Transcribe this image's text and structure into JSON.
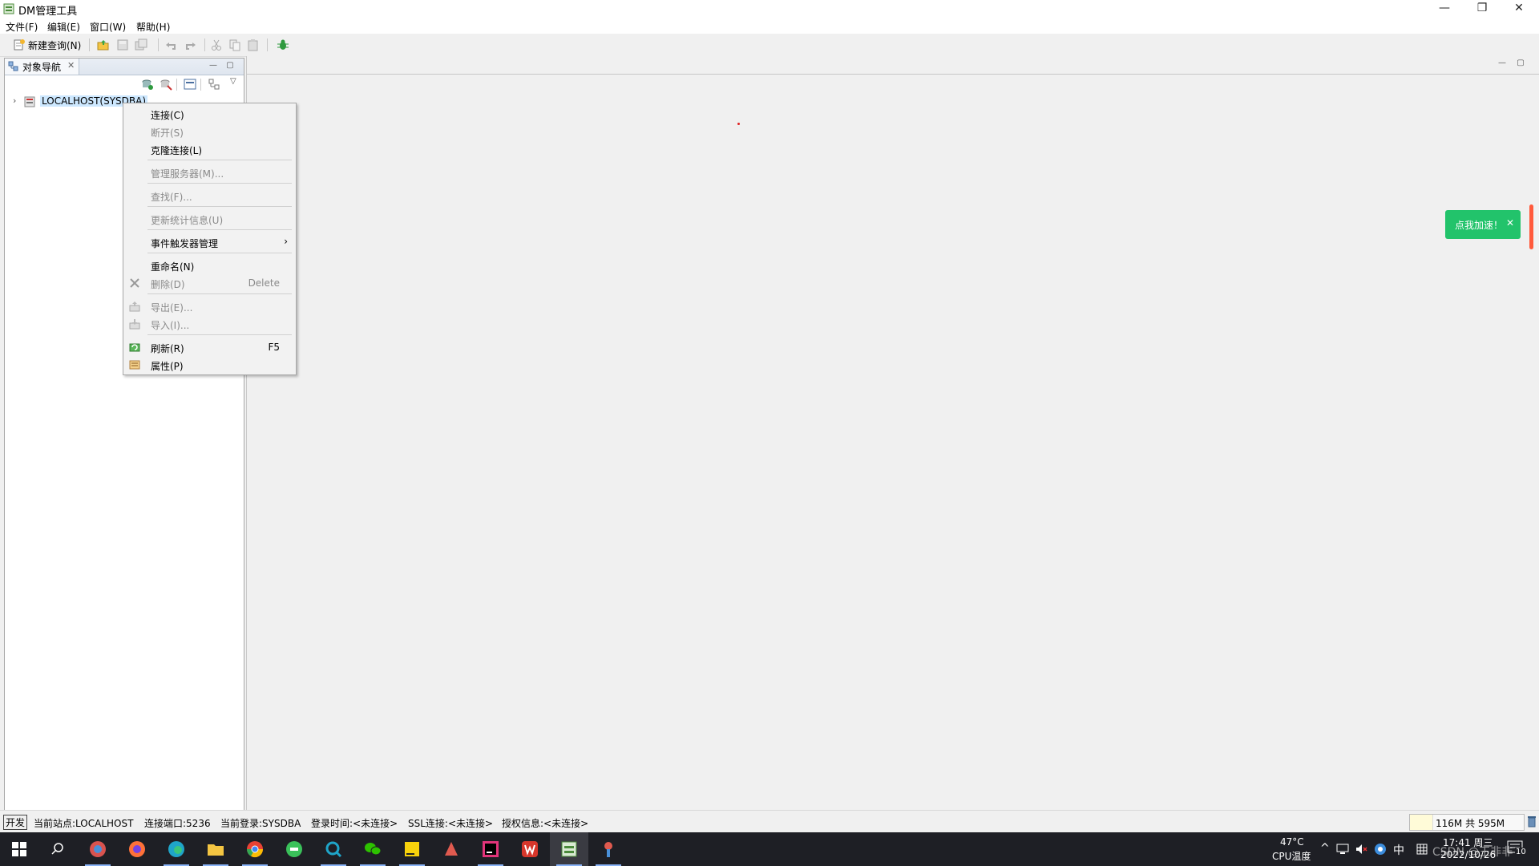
{
  "window": {
    "title": "DM管理工具",
    "controls": [
      "—",
      "❐",
      "✕"
    ]
  },
  "menubar": [
    "文件(F)",
    "编辑(E)",
    "窗口(W)",
    "帮助(H)"
  ],
  "toolbar": {
    "new_query": "新建查询(N)"
  },
  "navigator": {
    "tab_label": "对象导航",
    "tree": {
      "node_label": "LOCALHOST(SYSDBA)",
      "twisty": "›"
    }
  },
  "context_menu": {
    "items": [
      {
        "label": "连接(C)",
        "enabled": true
      },
      {
        "label": "断开(S)",
        "enabled": false
      },
      {
        "label": "克隆连接(L)",
        "enabled": true
      },
      {
        "label": "管理服务器(M)...",
        "enabled": false
      },
      {
        "label": "查找(F)...",
        "enabled": false
      },
      {
        "label": "更新统计信息(U)",
        "enabled": false
      },
      {
        "label": "事件触发器管理",
        "enabled": true,
        "submenu_arrow": "›"
      },
      {
        "label": "重命名(N)",
        "enabled": true
      },
      {
        "label": "删除(D)",
        "enabled": false,
        "shortcut": "Delete",
        "icon": "delete-x-icon"
      },
      {
        "label": "导出(E)...",
        "enabled": false,
        "icon": "export-icon"
      },
      {
        "label": "导入(I)...",
        "enabled": false,
        "icon": "import-icon"
      },
      {
        "label": "刷新(R)",
        "enabled": true,
        "shortcut": "F5",
        "icon": "refresh-icon"
      },
      {
        "label": "属性(P)",
        "enabled": true,
        "icon": "properties-icon"
      }
    ]
  },
  "accelerate": {
    "label": "点我加速！",
    "close": "✕"
  },
  "statusbar": {
    "mode": "开发",
    "current_site": "当前站点:LOCALHOST",
    "port": "连接端口:5236",
    "login": "当前登录:SYSDBA",
    "login_time": "登录时间:<未连接>",
    "ssl": "SSL连接:<未连接>",
    "license": "授权信息:<未连接>",
    "memory": "116M 共 595M",
    "memory_used_fraction": 0.195
  },
  "taskbar": {
    "temperature": "47°C",
    "cpu_label": "CPU温度",
    "ime": "中",
    "time": "17:41 周三",
    "date": "2022/10/26",
    "notification_count": "10",
    "watermark": "CSDN @王非非"
  },
  "colors": {
    "accent_green": "#22c36b",
    "selection_blue": "#cde8ff",
    "taskbar_bg": "#1e1f25"
  }
}
